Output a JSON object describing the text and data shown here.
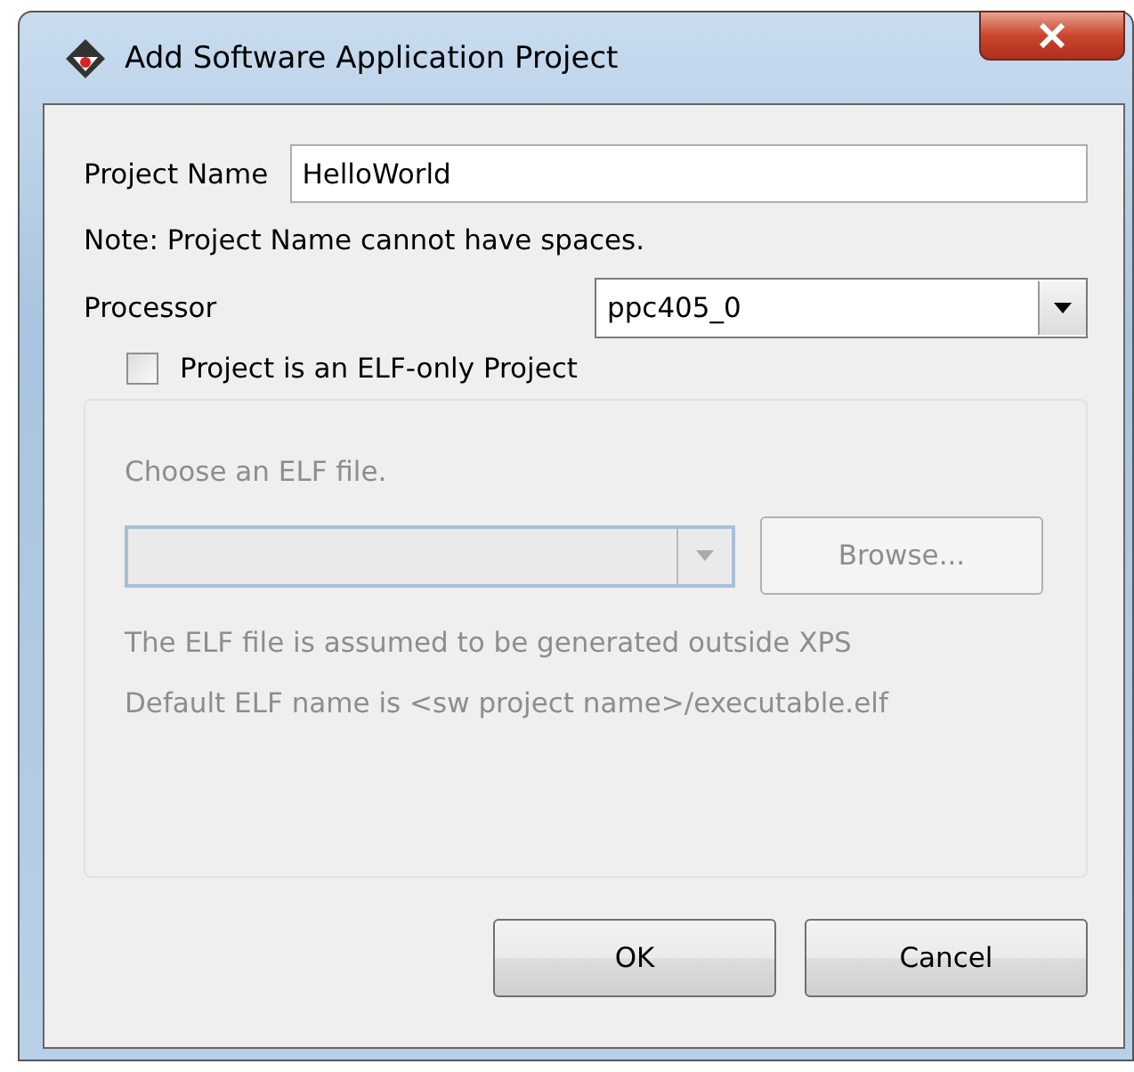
{
  "window": {
    "title": "Add Software Application Project"
  },
  "project_name": {
    "label": "Project Name",
    "value": "HelloWorld"
  },
  "note": "Note: Project Name cannot have spaces.",
  "processor": {
    "label": "Processor",
    "value": "ppc405_0"
  },
  "elf_group": {
    "checkbox": {
      "label": "Project is an ELF-only Project",
      "checked": false
    },
    "choose_label": "Choose an ELF file.",
    "browse_button": "Browse...",
    "info": [
      "The ELF file is assumed to be generated outside XPS",
      "Default ELF name is <sw project name>/executable.elf"
    ]
  },
  "buttons": [
    "OK",
    "Cancel"
  ]
}
